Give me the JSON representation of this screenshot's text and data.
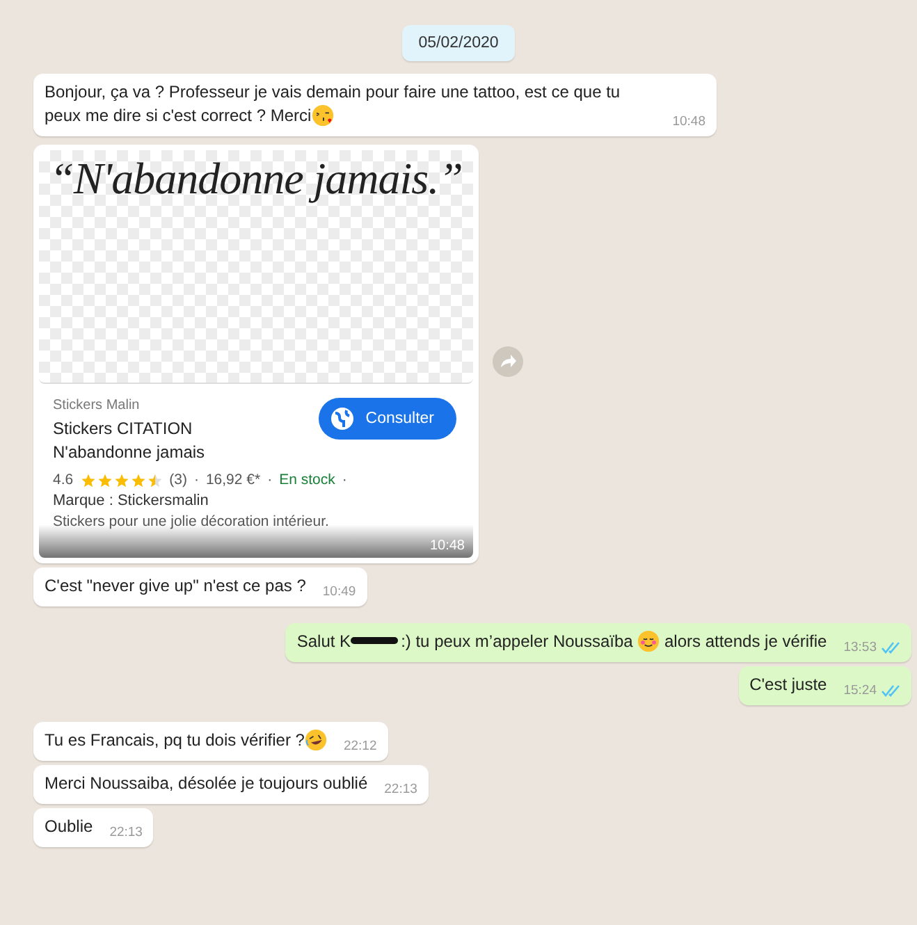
{
  "date_chip": "05/02/2020",
  "messages": [
    {
      "kind": "text",
      "outgoing": false,
      "parts": [
        {
          "kind": "text",
          "text": "Bonjour, ça va ? Professeur je vais demain pour faire une tattoo, est ce que tu peux me dire si c'est correct ? Merci"
        },
        {
          "kind": "kiss_emoji"
        }
      ],
      "time": "10:48"
    },
    {
      "kind": "product",
      "outgoing": false,
      "image_caption": "“N'abandonne jamais.”",
      "seller": "Stickers Malin",
      "title": "Stickers CITATION N'abandonne jamais",
      "button": "Consulter",
      "rating_line": [
        {
          "kind": "text",
          "text": "4.6"
        },
        {
          "kind": "stars",
          "stars": 4.5
        },
        {
          "kind": "text",
          "text": "(3)"
        },
        {
          "kind": "separator",
          "text": "·"
        },
        {
          "kind": "text",
          "text": "16,92 €*"
        },
        {
          "kind": "separator",
          "text": "·"
        },
        {
          "kind": "stock",
          "text": "En stock"
        },
        {
          "kind": "separator",
          "text": "·"
        }
      ],
      "brand": "Marque : Stickersmalin",
      "description": "Stickers pour une jolie décoration intérieur.",
      "time": "10:48"
    },
    {
      "kind": "text",
      "outgoing": false,
      "parts": [
        {
          "kind": "text",
          "text": "C'est \"never give up\" n'est ce pas ?"
        }
      ],
      "time": "10:49"
    },
    {
      "kind": "text",
      "outgoing": true,
      "parts": [
        {
          "kind": "text",
          "text": "Salut K"
        },
        {
          "kind": "redacted"
        },
        {
          "kind": "text",
          "text": ":) tu peux m’appeler Noussaïba "
        },
        {
          "kind": "smile_emoji"
        },
        {
          "kind": "text",
          "text": " alors attends je vérifie"
        }
      ],
      "time": "13:53",
      "read": true
    },
    {
      "kind": "text",
      "outgoing": true,
      "parts": [
        {
          "kind": "text",
          "text": "C'est juste"
        }
      ],
      "time": "15:24",
      "read": true
    },
    {
      "kind": "text",
      "outgoing": false,
      "parts": [
        {
          "kind": "text",
          "text": "Tu es Francais, pq tu dois vérifier ?"
        },
        {
          "kind": "laugh_emoji"
        }
      ],
      "time": "22:12"
    },
    {
      "kind": "text",
      "outgoing": false,
      "parts": [
        {
          "kind": "text",
          "text": "Merci Noussaiba, désolée je toujours oublié"
        }
      ],
      "time": "22:13"
    },
    {
      "kind": "text",
      "outgoing": false,
      "parts": [
        {
          "kind": "text",
          "text": "Oublie"
        }
      ],
      "time": "22:13"
    }
  ]
}
